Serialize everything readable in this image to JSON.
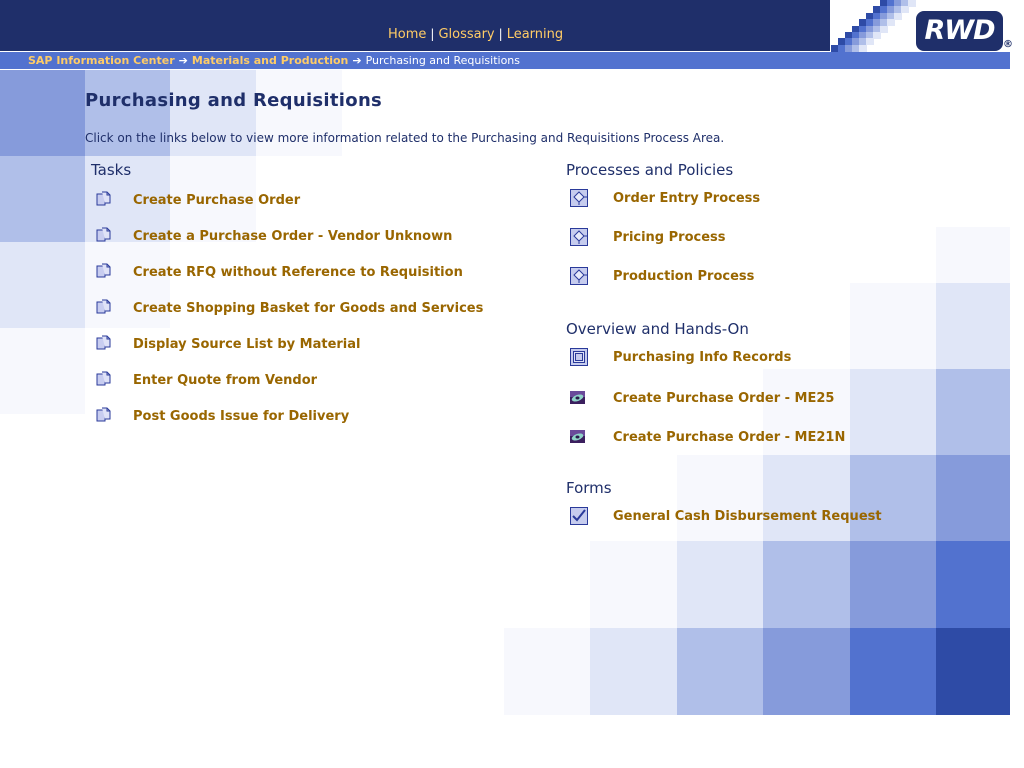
{
  "header": {
    "nav": [
      {
        "label": "Home"
      },
      {
        "label": "Glossary"
      },
      {
        "label": "Learning"
      }
    ],
    "separator": "|",
    "logo_text": "RWD",
    "registered_mark": "®"
  },
  "breadcrumb": {
    "items": [
      {
        "label": "SAP Information Center"
      },
      {
        "label": "Materials and Production"
      }
    ],
    "arrow": "➔",
    "current": "Purchasing and Requisitions"
  },
  "page": {
    "title": "Purchasing and Requisitions",
    "intro": "Click on the links below to view more information related to the Purchasing and Requisitions Process Area."
  },
  "tasks": {
    "title": "Tasks",
    "icon": "document-copy-icon",
    "items": [
      {
        "label": "Create Purchase Order"
      },
      {
        "label": "Create a Purchase Order - Vendor Unknown"
      },
      {
        "label": "Create RFQ without Reference to Requisition"
      },
      {
        "label": "Create Shopping Basket for Goods and Services"
      },
      {
        "label": "Display Source List by Material"
      },
      {
        "label": "Enter Quote from Vendor"
      },
      {
        "label": "Post Goods Issue for Delivery"
      }
    ]
  },
  "processes": {
    "title": "Processes and Policies",
    "icon": "process-flow-icon",
    "items": [
      {
        "label": "Order Entry Process"
      },
      {
        "label": "Pricing Process"
      },
      {
        "label": "Production Process"
      }
    ]
  },
  "overview": {
    "title": "Overview and Hands-On",
    "items": [
      {
        "label": "Purchasing Info Records",
        "icon": "overview-window-icon"
      },
      {
        "label": "Create Purchase Order - ME25",
        "icon": "simulation-eye-icon"
      },
      {
        "label": "Create Purchase Order - ME21N",
        "icon": "simulation-eye-icon"
      }
    ]
  },
  "forms": {
    "title": "Forms",
    "items": [
      {
        "label": "General Cash Disbursement Request",
        "icon": "checkbox-form-icon"
      }
    ]
  },
  "colors": {
    "header_bg": "#1f2f6a",
    "breadcrumb_bg": "#5272cf",
    "link": "#996600",
    "nav_link": "#ffcc66",
    "heading": "#1f2f6a"
  }
}
